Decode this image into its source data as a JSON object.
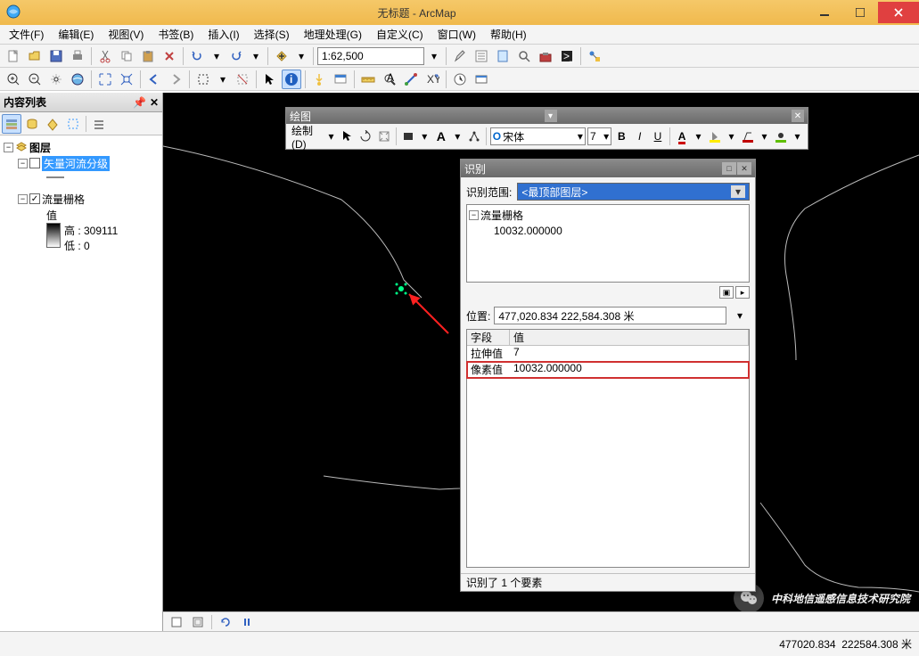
{
  "app": {
    "title": "无标题 - ArcMap"
  },
  "menu": {
    "file": "文件(F)",
    "edit": "编辑(E)",
    "view": "视图(V)",
    "bookmark": "书签(B)",
    "insert": "插入(I)",
    "select": "选择(S)",
    "geoproc": "地理处理(G)",
    "custom": "自定义(C)",
    "window": "窗口(W)",
    "help": "帮助(H)"
  },
  "toolbar1": {
    "scale": "1:62,500"
  },
  "toc": {
    "title": "内容列表",
    "root": "图层",
    "layer1": "矢量河流分级",
    "layer2": "流量栅格",
    "value_label": "值",
    "high": "高 : 309111",
    "low": "低 : 0"
  },
  "drawing": {
    "title": "绘图",
    "menu": "绘制(D)",
    "font": "宋体",
    "size": "7"
  },
  "identify": {
    "title": "识别",
    "scope_label": "识别范围:",
    "scope_value": "<最顶部图层>",
    "tree_root": "流量栅格",
    "tree_child": "10032.000000",
    "loc_label": "位置:",
    "loc_value": "477,020.834  222,584.308 米",
    "col_field": "字段",
    "col_value": "值",
    "row1_f": "拉伸值",
    "row1_v": "7",
    "row2_f": "像素值",
    "row2_v": "10032.000000",
    "status": "识别了 1 个要素"
  },
  "status": {
    "coords": "477020.834  222584.308 米"
  },
  "watermark": "中科地信遥感信息技术研究院"
}
